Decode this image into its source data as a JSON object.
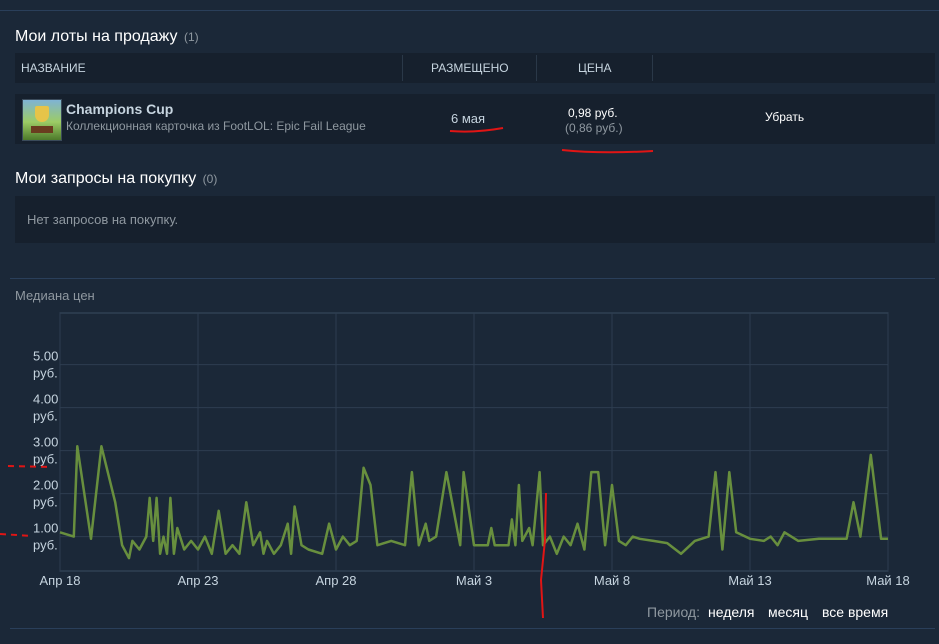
{
  "my_listings": {
    "title": "Мои лоты на продажу",
    "count": "(1)",
    "columns": {
      "name": "НАЗВАНИЕ",
      "listed": "РАЗМЕЩЕНО",
      "price": "ЦЕНА"
    },
    "rows": [
      {
        "item_name": "Champions Cup",
        "game_name": "Коллекционная карточка из FootLOL: Epic Fail League",
        "listed_on": "6 мая",
        "price": "0,98 руб.",
        "price_received": "(0,86 руб.)",
        "remove_label": "Убрать"
      }
    ]
  },
  "my_buy_orders": {
    "title": "Мои запросы на покупку",
    "count": "(0)",
    "empty_text": "Нет запросов на покупку."
  },
  "price_history": {
    "title": "Медиана цен",
    "period_label": "Период:",
    "period_options": [
      "неделя",
      "месяц",
      "все время"
    ]
  },
  "colors": {
    "line": "#688f3e",
    "background": "#1b2838",
    "annotation": "#e01515"
  },
  "chart_data": {
    "type": "line",
    "title": "Медиана цен",
    "y_unit": "руб.",
    "y_ticks": [
      "1.00",
      "2.00",
      "3.00",
      "4.00",
      "5.00"
    ],
    "y_tick_values": [
      1,
      2,
      3,
      4,
      5
    ],
    "ylim": [
      0.2,
      6.2
    ],
    "x_range": [
      "2019-04-18",
      "2019-05-18"
    ],
    "x_tick_labels": [
      "Апр 18",
      "Апр 23",
      "Апр 28",
      "Май 3",
      "Май 8",
      "Май 13",
      "Май 18"
    ],
    "x_tick_dates": [
      "2019-04-18",
      "2019-04-23",
      "2019-04-28",
      "2019-05-03",
      "2019-05-08",
      "2019-05-13",
      "2019-05-18"
    ],
    "grid": true,
    "series": [
      {
        "points": [
          [
            "2019-04-18T00:00",
            1.1
          ],
          [
            "2019-04-18T12:00",
            1.0
          ],
          [
            "2019-04-18T15:00",
            3.1
          ],
          [
            "2019-04-19T03:00",
            0.95
          ],
          [
            "2019-04-19T12:00",
            3.1
          ],
          [
            "2019-04-20T00:00",
            1.8
          ],
          [
            "2019-04-20T06:00",
            0.8
          ],
          [
            "2019-04-20T12:00",
            0.5
          ],
          [
            "2019-04-20T15:00",
            0.9
          ],
          [
            "2019-04-20T21:00",
            0.7
          ],
          [
            "2019-04-21T03:00",
            1.0
          ],
          [
            "2019-04-21T06:00",
            1.9
          ],
          [
            "2019-04-21T09:00",
            0.9
          ],
          [
            "2019-04-21T12:00",
            1.9
          ],
          [
            "2019-04-21T15:00",
            0.6
          ],
          [
            "2019-04-21T18:00",
            1.0
          ],
          [
            "2019-04-21T21:00",
            0.6
          ],
          [
            "2019-04-22T00:00",
            1.9
          ],
          [
            "2019-04-22T03:00",
            0.6
          ],
          [
            "2019-04-22T06:00",
            1.2
          ],
          [
            "2019-04-22T12:00",
            0.7
          ],
          [
            "2019-04-22T18:00",
            0.9
          ],
          [
            "2019-04-23T00:00",
            0.7
          ],
          [
            "2019-04-23T06:00",
            1.0
          ],
          [
            "2019-04-23T12:00",
            0.6
          ],
          [
            "2019-04-23T18:00",
            1.6
          ],
          [
            "2019-04-24T00:00",
            0.6
          ],
          [
            "2019-04-24T06:00",
            0.8
          ],
          [
            "2019-04-24T12:00",
            0.6
          ],
          [
            "2019-04-24T18:00",
            1.8
          ],
          [
            "2019-04-25T00:00",
            0.8
          ],
          [
            "2019-04-25T06:00",
            1.1
          ],
          [
            "2019-04-25T09:00",
            0.6
          ],
          [
            "2019-04-25T12:00",
            0.9
          ],
          [
            "2019-04-25T18:00",
            0.6
          ],
          [
            "2019-04-26T00:00",
            0.8
          ],
          [
            "2019-04-26T06:00",
            1.3
          ],
          [
            "2019-04-26T09:00",
            0.6
          ],
          [
            "2019-04-26T12:00",
            1.7
          ],
          [
            "2019-04-26T18:00",
            0.8
          ],
          [
            "2019-04-27T00:00",
            0.7
          ],
          [
            "2019-04-27T12:00",
            0.6
          ],
          [
            "2019-04-27T18:00",
            1.3
          ],
          [
            "2019-04-28T00:00",
            0.7
          ],
          [
            "2019-04-28T06:00",
            1.0
          ],
          [
            "2019-04-28T12:00",
            0.8
          ],
          [
            "2019-04-28T18:00",
            0.9
          ],
          [
            "2019-04-29T00:00",
            2.6
          ],
          [
            "2019-04-29T06:00",
            2.2
          ],
          [
            "2019-04-29T12:00",
            0.8
          ],
          [
            "2019-04-30T00:00",
            0.9
          ],
          [
            "2019-04-30T12:00",
            0.8
          ],
          [
            "2019-04-30T18:00",
            2.5
          ],
          [
            "2019-05-01T00:00",
            0.8
          ],
          [
            "2019-05-01T06:00",
            1.3
          ],
          [
            "2019-05-01T09:00",
            0.9
          ],
          [
            "2019-05-01T15:00",
            1.0
          ],
          [
            "2019-05-02T00:00",
            2.5
          ],
          [
            "2019-05-02T12:00",
            0.8
          ],
          [
            "2019-05-02T15:00",
            2.5
          ],
          [
            "2019-05-03T00:00",
            0.8
          ],
          [
            "2019-05-03T12:00",
            0.8
          ],
          [
            "2019-05-03T15:00",
            1.2
          ],
          [
            "2019-05-03T18:00",
            0.8
          ],
          [
            "2019-05-04T00:00",
            0.8
          ],
          [
            "2019-05-04T06:00",
            0.8
          ],
          [
            "2019-05-04T09:00",
            1.4
          ],
          [
            "2019-05-04T12:00",
            0.8
          ],
          [
            "2019-05-04T15:00",
            2.2
          ],
          [
            "2019-05-04T18:00",
            0.9
          ],
          [
            "2019-05-05T00:00",
            1.2
          ],
          [
            "2019-05-05T03:00",
            0.8
          ],
          [
            "2019-05-05T09:00",
            2.5
          ],
          [
            "2019-05-05T12:00",
            0.8
          ],
          [
            "2019-05-05T18:00",
            1.0
          ],
          [
            "2019-05-06T00:00",
            0.6
          ],
          [
            "2019-05-06T06:00",
            1.0
          ],
          [
            "2019-05-06T12:00",
            0.8
          ],
          [
            "2019-05-06T18:00",
            1.3
          ],
          [
            "2019-05-07T00:00",
            0.7
          ],
          [
            "2019-05-07T06:00",
            2.5
          ],
          [
            "2019-05-07T12:00",
            2.5
          ],
          [
            "2019-05-07T18:00",
            0.8
          ],
          [
            "2019-05-08T00:00",
            2.2
          ],
          [
            "2019-05-08T06:00",
            0.9
          ],
          [
            "2019-05-08T12:00",
            0.8
          ],
          [
            "2019-05-08T18:00",
            1.0
          ],
          [
            "2019-05-09T00:00",
            0.95
          ],
          [
            "2019-05-09T12:00",
            0.9
          ],
          [
            "2019-05-10T00:00",
            0.85
          ],
          [
            "2019-05-10T12:00",
            0.6
          ],
          [
            "2019-05-11T00:00",
            0.9
          ],
          [
            "2019-05-11T12:00",
            1.0
          ],
          [
            "2019-05-11T18:00",
            2.5
          ],
          [
            "2019-05-12T00:00",
            0.7
          ],
          [
            "2019-05-12T06:00",
            2.5
          ],
          [
            "2019-05-12T12:00",
            1.1
          ],
          [
            "2019-05-13T00:00",
            0.95
          ],
          [
            "2019-05-13T12:00",
            0.9
          ],
          [
            "2019-05-13T18:00",
            1.0
          ],
          [
            "2019-05-14T00:00",
            0.8
          ],
          [
            "2019-05-14T06:00",
            1.1
          ],
          [
            "2019-05-14T18:00",
            0.9
          ],
          [
            "2019-05-15T12:00",
            0.95
          ],
          [
            "2019-05-16T12:00",
            0.95
          ],
          [
            "2019-05-16T18:00",
            1.8
          ],
          [
            "2019-05-17T00:00",
            1.0
          ],
          [
            "2019-05-17T09:00",
            2.9
          ],
          [
            "2019-05-17T18:00",
            0.95
          ],
          [
            "2019-05-18T00:00",
            0.95
          ]
        ]
      }
    ]
  }
}
